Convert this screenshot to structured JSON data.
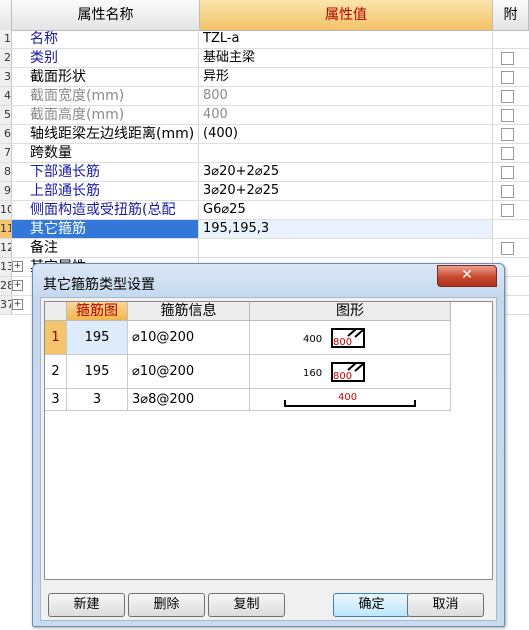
{
  "grid": {
    "header": {
      "name": "属性名称",
      "value": "属性值",
      "attach": "附"
    },
    "rows": [
      {
        "num": "1",
        "name": "名称",
        "value": "TZL-a",
        "style": "blue",
        "check": false
      },
      {
        "num": "2",
        "name": "类别",
        "value": "基础主梁",
        "style": "blue",
        "check": true
      },
      {
        "num": "3",
        "name": "截面形状",
        "value": "异形",
        "style": "black",
        "check": true
      },
      {
        "num": "4",
        "name": "截面宽度(mm)",
        "value": "800",
        "style": "gray",
        "check": true
      },
      {
        "num": "5",
        "name": "截面高度(mm)",
        "value": "400",
        "style": "gray",
        "check": true
      },
      {
        "num": "6",
        "name": "轴线距梁左边线距离(mm)",
        "value": "(400)",
        "style": "black",
        "check": true
      },
      {
        "num": "7",
        "name": "跨数量",
        "value": "",
        "style": "black",
        "check": true
      },
      {
        "num": "8",
        "name": "下部通长筋",
        "value": "3⌀20+2⌀25",
        "style": "blue",
        "check": true
      },
      {
        "num": "9",
        "name": "上部通长筋",
        "value": "3⌀20+2⌀25",
        "style": "blue",
        "check": true
      },
      {
        "num": "10",
        "name": "侧面构造或受扭筋(总配",
        "value": "G6⌀25",
        "style": "blue",
        "check": true
      },
      {
        "num": "11",
        "name": "其它箍筋",
        "value": "195,195,3",
        "style": "black",
        "check": false
      },
      {
        "num": "12",
        "name": "备注",
        "value": "",
        "style": "black",
        "check": true
      },
      {
        "num": "13",
        "name": "其它属性",
        "value": "",
        "style": "black",
        "check": false
      },
      {
        "num": "28",
        "name": "",
        "value": "",
        "style": "black",
        "check": false
      },
      {
        "num": "37",
        "name": "",
        "value": "",
        "style": "black",
        "check": false
      }
    ]
  },
  "dialog": {
    "title": "其它箍筋类型设置",
    "close_glyph": "✕",
    "columns": [
      "箍筋图",
      "箍筋信息",
      "图形"
    ],
    "rows": [
      {
        "num": "1",
        "code": "195",
        "info": "⌀10@200",
        "dim_left": "400",
        "dim_inner": "800",
        "shape": "rect"
      },
      {
        "num": "2",
        "code": "195",
        "info": "⌀10@200",
        "dim_left": "160",
        "dim_inner": "800",
        "shape": "rect"
      },
      {
        "num": "3",
        "code": "3",
        "info": "3⌀8@200",
        "dim_left": "",
        "dim_inner": "400",
        "shape": "bar"
      }
    ],
    "buttons": {
      "new": "新建",
      "delete": "删除",
      "copy": "复制",
      "ok": "确定",
      "cancel": "取消"
    }
  },
  "colors": {
    "dim_red": "#d00000",
    "value_header": "#f3c266",
    "selected_name": "#3378d8"
  }
}
